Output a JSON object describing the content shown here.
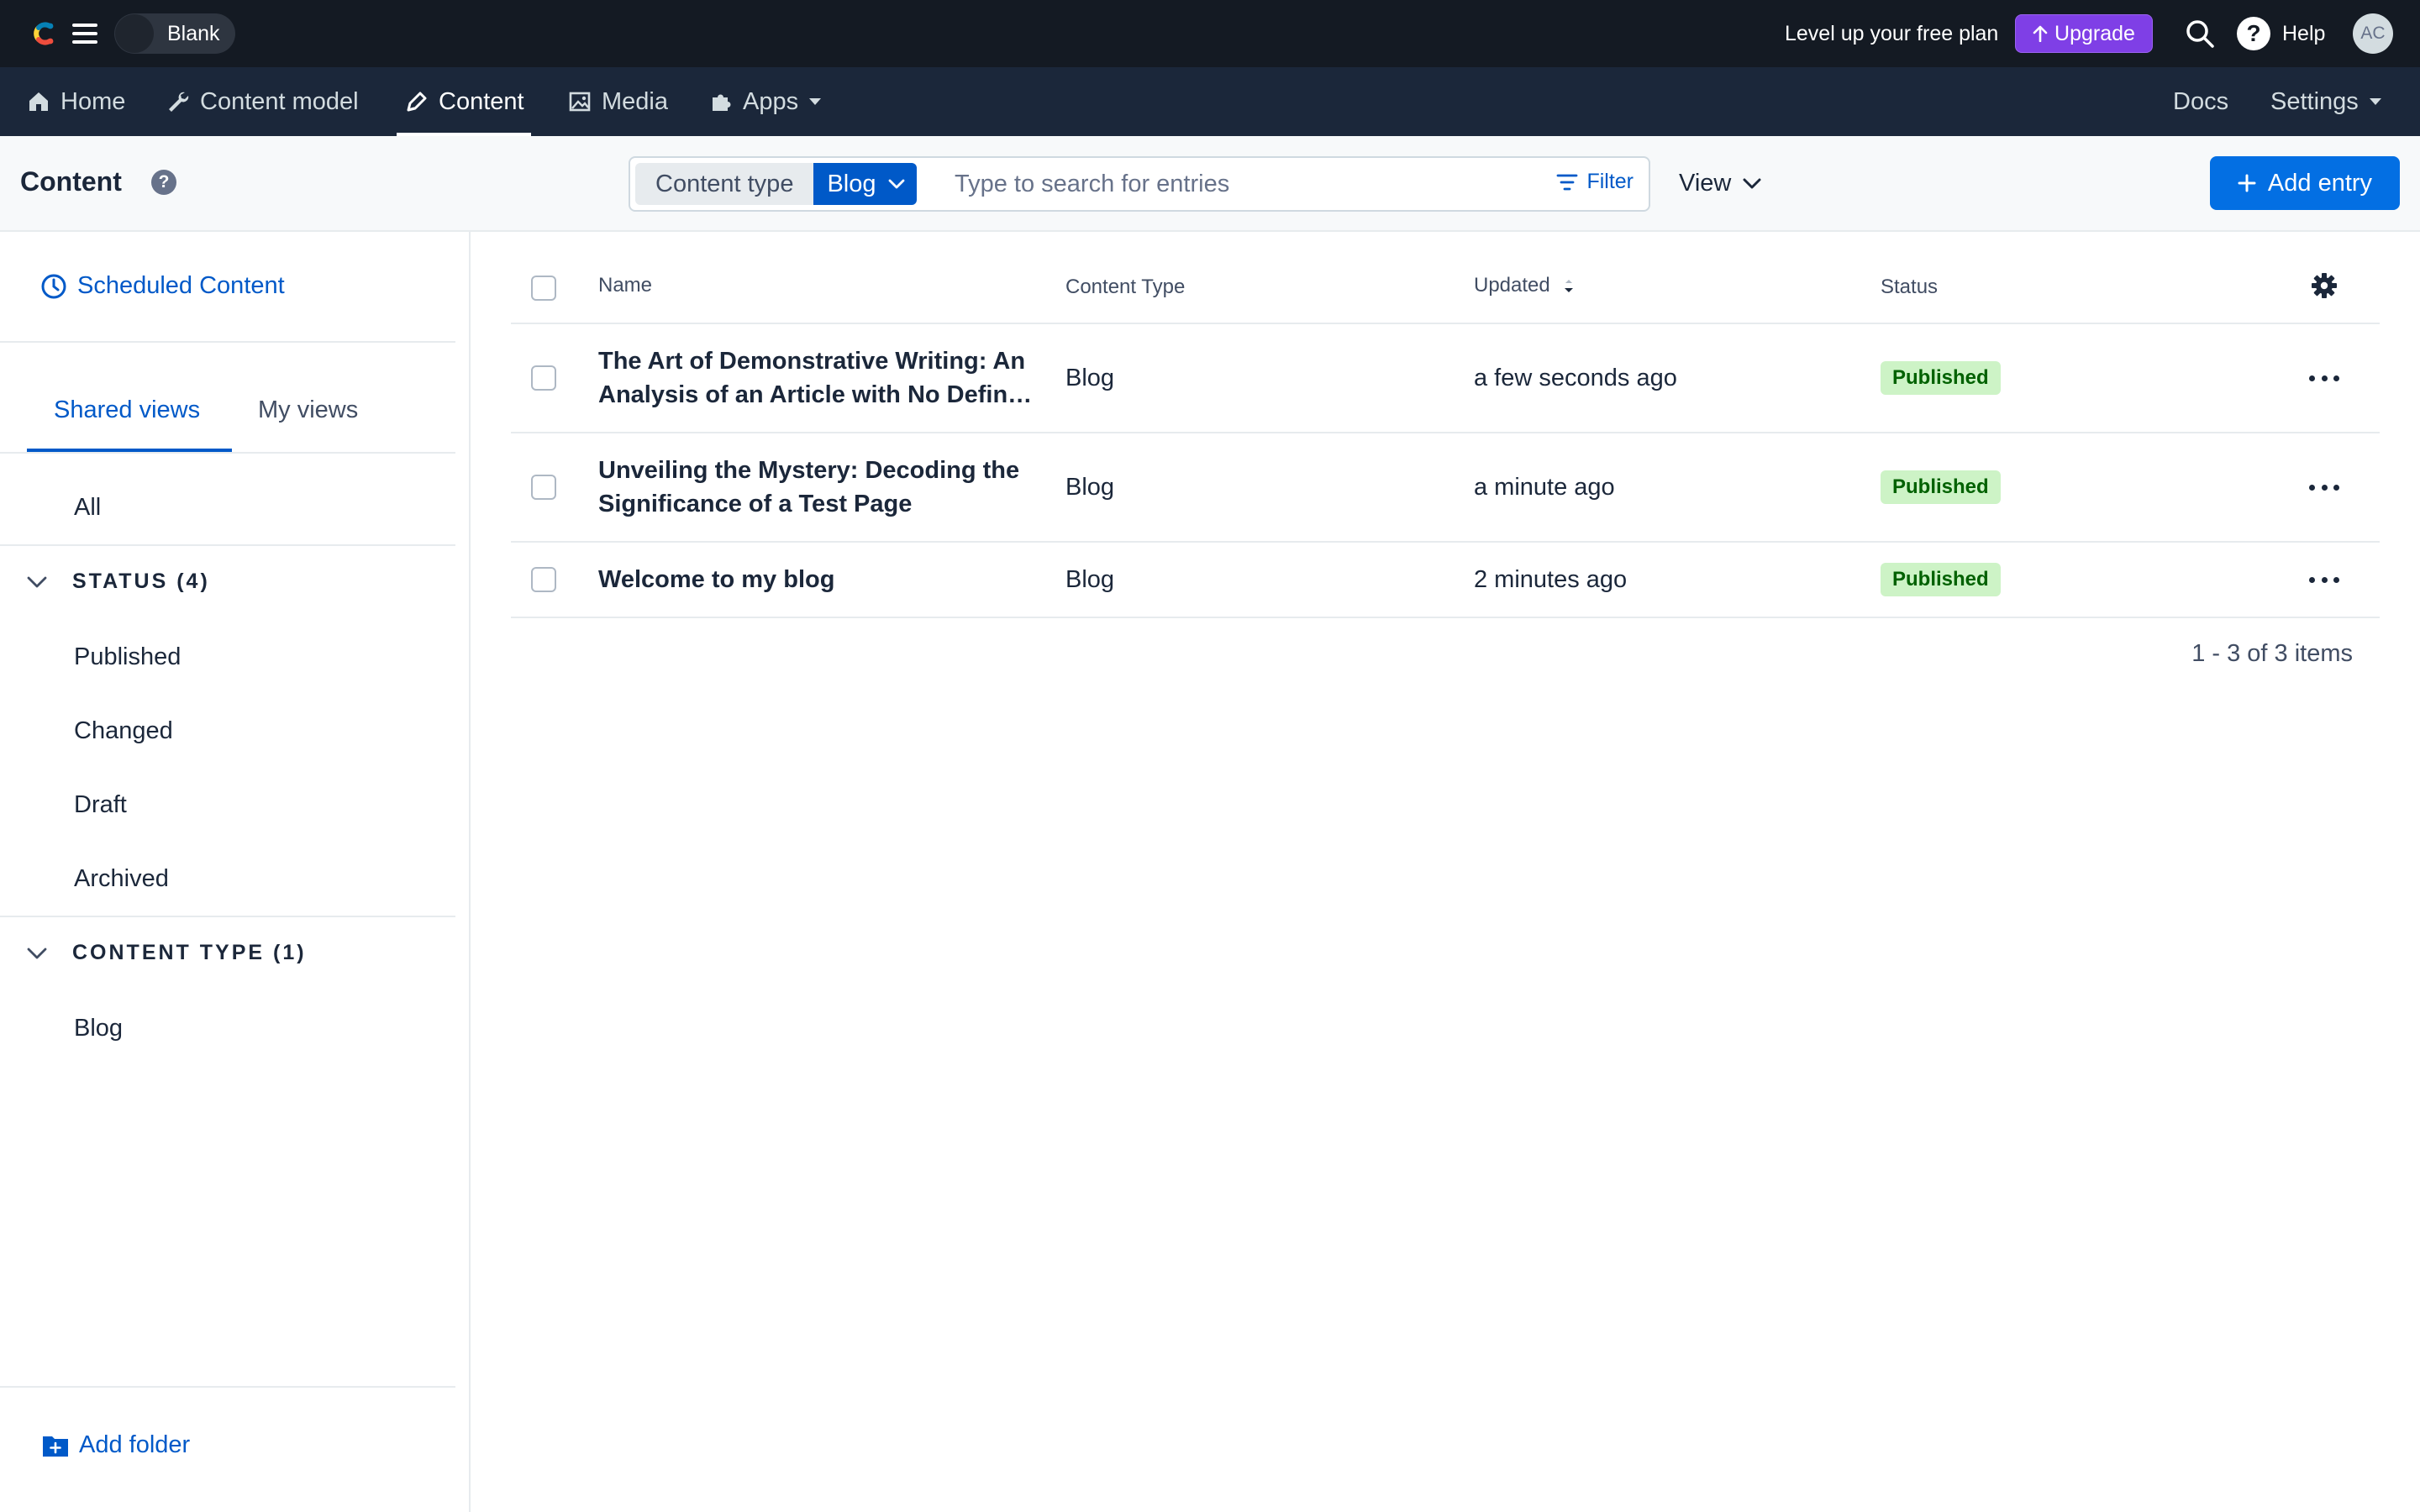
{
  "topbar": {
    "space_name": "Blank",
    "promo_text": "Level up your free plan",
    "upgrade_label": "Upgrade",
    "help_label": "Help",
    "avatar_initials": "AC"
  },
  "nav": {
    "items": [
      {
        "label": "Home",
        "icon": "home-icon"
      },
      {
        "label": "Content model",
        "icon": "wrench-icon"
      },
      {
        "label": "Content",
        "icon": "pen-icon",
        "active": true
      },
      {
        "label": "Media",
        "icon": "image-icon"
      },
      {
        "label": "Apps",
        "icon": "puzzle-icon"
      }
    ],
    "docs_label": "Docs",
    "settings_label": "Settings"
  },
  "header": {
    "title": "Content",
    "content_type_label": "Content type",
    "content_type_value": "Blog",
    "search_placeholder": "Type to search for entries",
    "filter_label": "Filter",
    "view_label": "View",
    "add_entry_label": "Add entry"
  },
  "sidebar": {
    "scheduled_label": "Scheduled Content",
    "tabs": [
      "Shared views",
      "My views"
    ],
    "all_label": "All",
    "status_section": "STATUS (4)",
    "status_items": [
      "Published",
      "Changed",
      "Draft",
      "Archived"
    ],
    "content_type_section": "CONTENT TYPE (1)",
    "content_type_items": [
      "Blog"
    ],
    "add_folder_label": "Add folder"
  },
  "table": {
    "columns": [
      "Name",
      "Content Type",
      "Updated",
      "Status"
    ],
    "rows": [
      {
        "name_line1": "The Art of Demonstrative Writing: An",
        "name_line2": "Analysis of an Article with No Define...",
        "content_type": "Blog",
        "updated": "a few seconds ago",
        "status": "Published"
      },
      {
        "name_line1": "Unveiling the Mystery: Decoding the",
        "name_line2": "Significance of a Test Page",
        "content_type": "Blog",
        "updated": "a minute ago",
        "status": "Published"
      },
      {
        "name_line1": "Welcome to my blog",
        "name_line2": "",
        "content_type": "Blog",
        "updated": "2 minutes ago",
        "status": "Published"
      }
    ],
    "pagination": "1 - 3 of 3 items"
  },
  "colors": {
    "topbar_bg": "#141a23",
    "nav_bg": "#1b273a",
    "primary_blue": "#036fe3",
    "upgrade_purple": "#7f3fe6",
    "published_bg": "#cdf3c6",
    "published_text": "#006100"
  }
}
